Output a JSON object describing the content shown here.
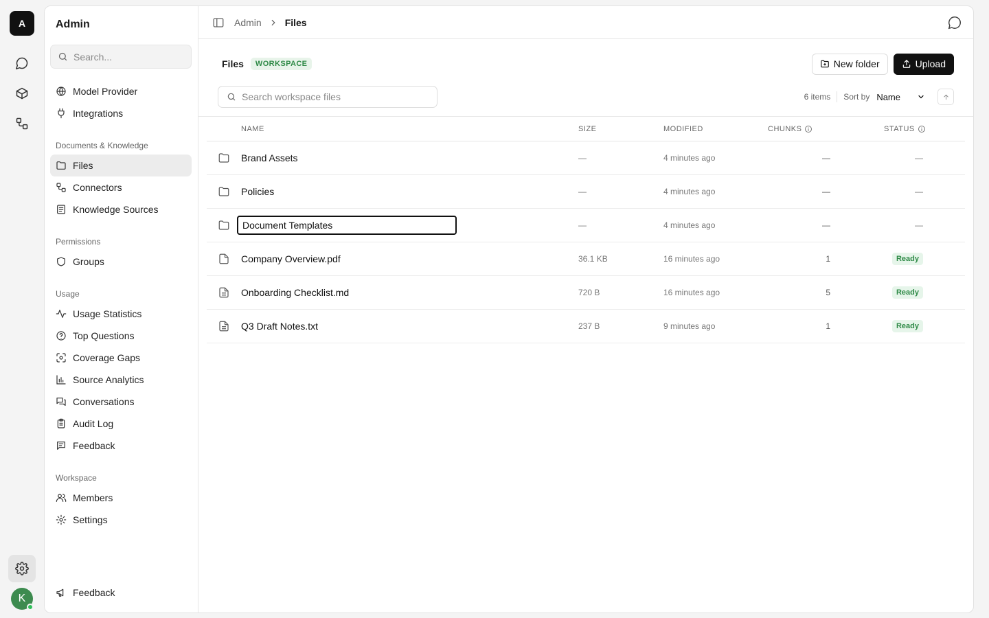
{
  "rail": {
    "logo_letter": "A",
    "avatar_letter": "K",
    "icons": [
      "chat-icon",
      "box-icon",
      "workflow-icon"
    ],
    "settings_icon": "gear-icon"
  },
  "sidebar": {
    "title": "Admin",
    "search_placeholder": "Search...",
    "top_items": [
      {
        "label": "Model Provider",
        "icon": "globe-icon"
      },
      {
        "label": "Integrations",
        "icon": "plug-icon"
      }
    ],
    "sections": [
      {
        "title": "Documents & Knowledge",
        "items": [
          {
            "label": "Files",
            "icon": "folder-icon",
            "active": true
          },
          {
            "label": "Connectors",
            "icon": "connector-icon"
          },
          {
            "label": "Knowledge Sources",
            "icon": "book-icon"
          }
        ]
      },
      {
        "title": "Permissions",
        "items": [
          {
            "label": "Groups",
            "icon": "shield-icon"
          }
        ]
      },
      {
        "title": "Usage",
        "items": [
          {
            "label": "Usage Statistics",
            "icon": "activity-icon"
          },
          {
            "label": "Top Questions",
            "icon": "question-icon"
          },
          {
            "label": "Coverage Gaps",
            "icon": "scan-icon"
          },
          {
            "label": "Source Analytics",
            "icon": "bar-chart-icon"
          },
          {
            "label": "Conversations",
            "icon": "messages-icon"
          },
          {
            "label": "Audit Log",
            "icon": "clipboard-icon"
          },
          {
            "label": "Feedback",
            "icon": "message-square-icon"
          }
        ]
      },
      {
        "title": "Workspace",
        "items": [
          {
            "label": "Members",
            "icon": "users-icon"
          },
          {
            "label": "Settings",
            "icon": "gear-icon"
          }
        ]
      }
    ],
    "footer_item": {
      "label": "Feedback",
      "icon": "megaphone-icon"
    }
  },
  "breadcrumb": {
    "parent": "Admin",
    "current": "Files"
  },
  "header": {
    "title": "Files",
    "badge": "WORKSPACE",
    "new_folder_label": "New folder",
    "upload_label": "Upload"
  },
  "toolbar": {
    "search_placeholder": "Search workspace files",
    "item_count": "6 items",
    "sort_label": "Sort by",
    "sort_value": "Name"
  },
  "table": {
    "columns": {
      "name": "NAME",
      "size": "SIZE",
      "modified": "MODIFIED",
      "chunks": "CHUNKS",
      "status": "STATUS"
    },
    "rows": [
      {
        "type": "folder",
        "name": "Brand Assets",
        "size": "—",
        "modified": "4 minutes ago",
        "chunks": "—",
        "status": "—"
      },
      {
        "type": "folder",
        "name": "Policies",
        "size": "—",
        "modified": "4 minutes ago",
        "chunks": "—",
        "status": "—"
      },
      {
        "type": "folder",
        "name": "Document Templates",
        "size": "—",
        "modified": "4 minutes ago",
        "chunks": "—",
        "status": "—",
        "editing": true
      },
      {
        "type": "file",
        "name": "Company Overview.pdf",
        "size": "36.1 KB",
        "modified": "16 minutes ago",
        "chunks": "1",
        "status": "Ready"
      },
      {
        "type": "file-text",
        "name": "Onboarding Checklist.md",
        "size": "720 B",
        "modified": "16 minutes ago",
        "chunks": "5",
        "status": "Ready"
      },
      {
        "type": "file-text",
        "name": "Q3 Draft Notes.txt",
        "size": "237 B",
        "modified": "9 minutes ago",
        "chunks": "1",
        "status": "Ready"
      }
    ]
  },
  "colors": {
    "accent_green": "#2f8a47",
    "badge_bg": "#e8f4ea",
    "dark": "#111111"
  }
}
